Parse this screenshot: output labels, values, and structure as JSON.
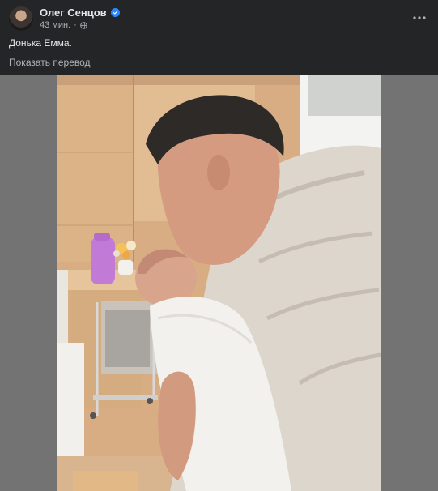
{
  "post": {
    "author_name": "Олег Сенцов",
    "timestamp": "43 мин.",
    "separator": "·",
    "text": "Донька Емма.",
    "translate_label": "Показать перевод"
  },
  "icons": {
    "verified": "verified-badge-icon",
    "privacy": "globe-icon",
    "more": "more-options-icon"
  },
  "colors": {
    "background": "#242526",
    "primary_text": "#e4e6eb",
    "secondary_text": "#b0b3b8",
    "verified": "#2d88ff",
    "media_backdrop": "#737373"
  }
}
